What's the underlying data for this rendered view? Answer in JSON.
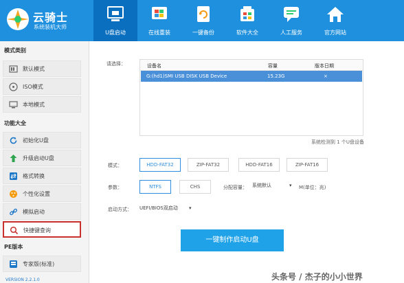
{
  "app": {
    "title": "云骑士",
    "subtitle": "系统装机大师"
  },
  "nav": [
    {
      "label": "U盘启动",
      "icon": "usb-boot-icon"
    },
    {
      "label": "在线重装",
      "icon": "windows-icon"
    },
    {
      "label": "一键备份",
      "icon": "backup-icon"
    },
    {
      "label": "软件大全",
      "icon": "software-box-icon"
    },
    {
      "label": "人工服务",
      "icon": "chat-service-icon"
    },
    {
      "label": "官方网站",
      "icon": "home-icon"
    }
  ],
  "sidebar": {
    "section_modes": "模式类别",
    "modes": [
      "默认模式",
      "ISO模式",
      "本地模式"
    ],
    "section_features": "功能大全",
    "features": [
      "初始化U盘",
      "升级启动U盘",
      "格式转换",
      "个性化设置",
      "模拟启动",
      "快捷键查询"
    ],
    "section_pe": "PE版本",
    "pe": [
      "专家版(标准)"
    ],
    "version": "VERSION 2.2.1.0"
  },
  "content": {
    "select_label": "请选择：",
    "table": {
      "headers": [
        "设备名",
        "容量",
        "版本日期"
      ],
      "rows": [
        {
          "name": "G:(hd1)SMI USB DISK USB Device",
          "size": "15.23G",
          "date": "×"
        }
      ],
      "status": "系统检测到 1 个U盘设备"
    },
    "mode_label": "模式：",
    "modes": [
      "HDD-FAT32",
      "ZIP-FAT32",
      "HDD-FAT16",
      "ZIP-FAT16"
    ],
    "params_label": "参数：",
    "params": [
      "NTFS",
      "CHS"
    ],
    "alloc_label": "分配容量：",
    "alloc_value": "系统默认",
    "unit_label": "M(单位：兆)",
    "boot_label": "启动方式：",
    "boot_value": "UEFI/BIOS双启动",
    "make_button": "一键制作启动U盘"
  },
  "watermark": "头条号 / 杰子的小小世界",
  "colors": {
    "header": "#1e90dd",
    "active_nav": "#0b6fbf",
    "accent": "#2a8de0",
    "selected_row": "#4a90d9",
    "highlight": "#c9302c"
  }
}
